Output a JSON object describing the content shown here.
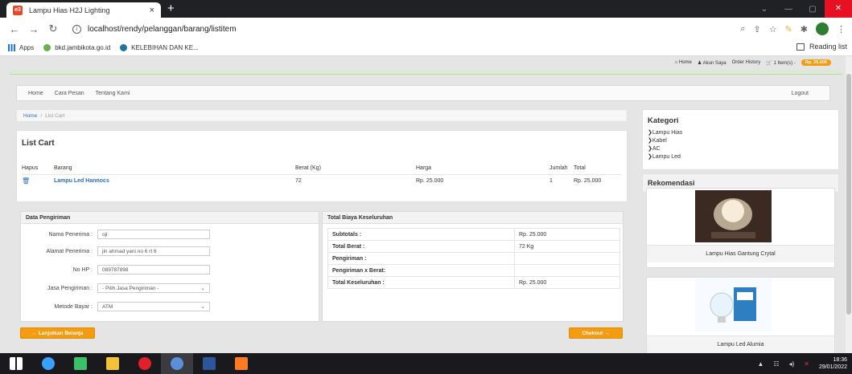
{
  "browser": {
    "tab_title": "Lampu Hias H2J Lighting",
    "tab_close": "×",
    "new_tab": "+",
    "url": "localhost/rendy/pelanggan/barang/listitem",
    "bookmarks": [
      "Apps",
      "bkd.jambikota.go.id",
      "KELEBIHAN DAN KE..."
    ],
    "reading_list": "Reading list"
  },
  "topmenu": {
    "home": "Home",
    "akun": "Akun Saya",
    "order": "Order History",
    "cart": "1 Item(s) -",
    "cart_badge": "Rp. 25.000"
  },
  "nav": {
    "items": [
      "Home",
      "Cara Pesan",
      "Tentang Kami"
    ],
    "logout": "Logout"
  },
  "breadcrumb": {
    "home": "Home",
    "sep": "/",
    "current": "List Cart"
  },
  "cart": {
    "title": "List Cart",
    "headers": [
      "Hapus",
      "Barang",
      "Berat (Kg)",
      "Harga",
      "Jumlah",
      "Total"
    ],
    "rows": [
      {
        "item": "Lampu Led Hannocs",
        "berat": "72",
        "harga": "Rp. 25.000",
        "jumlah": "1",
        "total": "Rp. 25.000"
      }
    ]
  },
  "shipping": {
    "title": "Data Pengiriman",
    "nama_label": "Nama Penerima :",
    "nama_value": "oji",
    "alamat_label": "Alamat Penerima :",
    "alamat_value": "jln ahmad yani no 6 rt 6",
    "hp_label": "No HP :",
    "hp_value": "089787898",
    "jasa_label": "Jasa Pengiriman :",
    "jasa_value": "- Pilih Jasa Pengiriman -",
    "metode_label": "Metode Bayar :",
    "metode_value": "ATM"
  },
  "totals": {
    "title": "Total Biaya Keseluruhan",
    "rows": [
      {
        "label": "Subtotals :",
        "value": "Rp. 25.000"
      },
      {
        "label": "Total Berat :",
        "value": "72 Kg"
      },
      {
        "label": "Pengiriman :",
        "value": ""
      },
      {
        "label": "Pengiriman x Berat:",
        "value": ""
      },
      {
        "label": "Total Keseluruhan :",
        "value": "Rp. 25.000"
      }
    ]
  },
  "buttons": {
    "lanjutkan": "← Lanjutkan Belanja",
    "checkout": "Chekout →"
  },
  "kategori": {
    "title": "Kategori",
    "items": [
      "Lampu Hias",
      "Kabel",
      "AC",
      "Lampu Led"
    ]
  },
  "rekomendasi": {
    "title": "Rekomendasi",
    "products": [
      {
        "name": "Lampu Hias Gantung Crytal"
      },
      {
        "name": "Lampu Led Alumia"
      }
    ]
  },
  "taskbar": {
    "time": "18:36",
    "date": "29/01/2022"
  },
  "colors": {
    "accent": "#f39c12",
    "link": "#2a6ebb"
  }
}
